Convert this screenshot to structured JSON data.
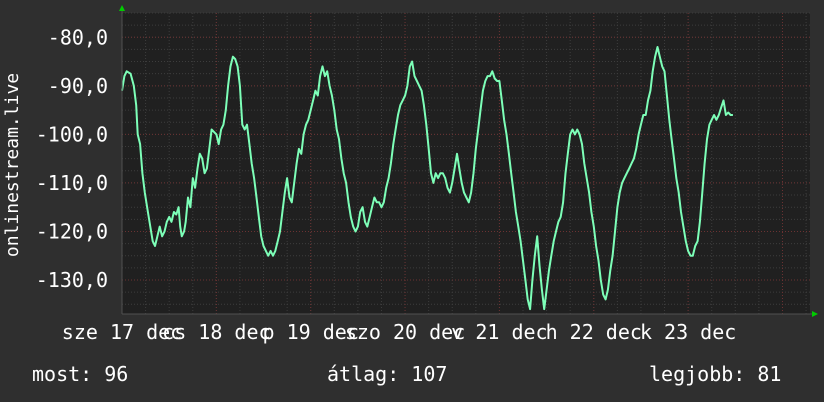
{
  "colors": {
    "background": "#2f2f2f",
    "canvas": "#202020",
    "line": "#7dffb8",
    "grid_minor": "#3d3d3d",
    "grid_major": "#6b3232",
    "axis_arrow": "#00cc00",
    "text": "#ffffff"
  },
  "stats": {
    "now_label": "most:",
    "now_value": "96",
    "avg_label": "átlag:",
    "avg_value": "107",
    "max_label": "legjobb:",
    "max_value": "81"
  },
  "chart_data": {
    "type": "line",
    "title": "",
    "xlabel": "",
    "ylabel": "onlinestream.live",
    "ylim": [
      -137,
      -75
    ],
    "yticks": [
      -80,
      -90,
      -100,
      -110,
      -120,
      -130
    ],
    "ytick_labels": [
      "-80,0",
      "-90,0",
      "-100,0",
      "-110,0",
      "-120,0",
      "-130,0"
    ],
    "xlim": [
      0,
      175
    ],
    "xticks": [
      0,
      24,
      48,
      72,
      96,
      120,
      144,
      168
    ],
    "xtick_labels": [
      "sze 17 dec",
      "cs 18 dec",
      "p 19 dec",
      "szo 20 dec",
      "v 21 dec",
      "h 22 dec",
      "k 23 dec",
      ""
    ],
    "grid": true,
    "series": [
      {
        "values": [
          [
            0,
            -91
          ],
          [
            0.6,
            -88
          ],
          [
            1.2,
            -87
          ],
          [
            2.2,
            -87.5
          ],
          [
            3,
            -90
          ],
          [
            3.6,
            -94
          ],
          [
            4,
            -100
          ],
          [
            4.6,
            -102
          ],
          [
            5.2,
            -108
          ],
          [
            5.8,
            -112
          ],
          [
            6.6,
            -116
          ],
          [
            7.2,
            -119
          ],
          [
            7.8,
            -122
          ],
          [
            8.4,
            -123
          ],
          [
            9,
            -121
          ],
          [
            9.6,
            -119
          ],
          [
            10.2,
            -121
          ],
          [
            10.8,
            -120
          ],
          [
            11.4,
            -118
          ],
          [
            12,
            -117
          ],
          [
            12.6,
            -118
          ],
          [
            13.2,
            -116
          ],
          [
            13.8,
            -116.5
          ],
          [
            14.4,
            -115
          ],
          [
            14.8,
            -119
          ],
          [
            15.2,
            -121
          ],
          [
            15.8,
            -120
          ],
          [
            16.2,
            -118
          ],
          [
            16.8,
            -113
          ],
          [
            17.4,
            -115
          ],
          [
            18,
            -109
          ],
          [
            18.6,
            -111
          ],
          [
            19.2,
            -107
          ],
          [
            19.8,
            -104
          ],
          [
            20.4,
            -105
          ],
          [
            21,
            -108
          ],
          [
            21.6,
            -107
          ],
          [
            22.2,
            -103
          ],
          [
            22.8,
            -99
          ],
          [
            23.4,
            -99.5
          ],
          [
            24,
            -100
          ],
          [
            24.6,
            -102
          ],
          [
            25.2,
            -99
          ],
          [
            25.8,
            -98
          ],
          [
            26.4,
            -95
          ],
          [
            27,
            -90
          ],
          [
            27.6,
            -86
          ],
          [
            28.2,
            -84
          ],
          [
            28.8,
            -84.5
          ],
          [
            29.4,
            -86
          ],
          [
            30,
            -90
          ],
          [
            30.6,
            -98
          ],
          [
            31.2,
            -99
          ],
          [
            31.8,
            -98
          ],
          [
            32.4,
            -102
          ],
          [
            33,
            -106
          ],
          [
            33.6,
            -109
          ],
          [
            34.2,
            -113
          ],
          [
            34.8,
            -117
          ],
          [
            35.4,
            -121
          ],
          [
            36,
            -123
          ],
          [
            36.6,
            -124
          ],
          [
            37.2,
            -125
          ],
          [
            37.8,
            -124
          ],
          [
            38.4,
            -125
          ],
          [
            39,
            -124
          ],
          [
            39.6,
            -122
          ],
          [
            40.2,
            -120
          ],
          [
            40.8,
            -116
          ],
          [
            41.4,
            -112
          ],
          [
            42,
            -109
          ],
          [
            42.6,
            -113
          ],
          [
            43.2,
            -114
          ],
          [
            43.8,
            -110
          ],
          [
            44.4,
            -106
          ],
          [
            45,
            -103
          ],
          [
            45.6,
            -104
          ],
          [
            46.2,
            -100
          ],
          [
            46.8,
            -98
          ],
          [
            47.4,
            -97
          ],
          [
            48,
            -95
          ],
          [
            48.6,
            -93
          ],
          [
            49.2,
            -91
          ],
          [
            49.8,
            -92
          ],
          [
            50.4,
            -88
          ],
          [
            51,
            -86
          ],
          [
            51.6,
            -88
          ],
          [
            52.2,
            -87
          ],
          [
            52.8,
            -90
          ],
          [
            53.4,
            -92
          ],
          [
            54,
            -95
          ],
          [
            54.6,
            -99
          ],
          [
            55.2,
            -101
          ],
          [
            55.8,
            -105
          ],
          [
            56.4,
            -108
          ],
          [
            57,
            -110
          ],
          [
            57.6,
            -114
          ],
          [
            58.2,
            -117
          ],
          [
            58.8,
            -119
          ],
          [
            59.4,
            -120
          ],
          [
            60,
            -119
          ],
          [
            60.6,
            -116
          ],
          [
            61.2,
            -115
          ],
          [
            61.8,
            -118
          ],
          [
            62.4,
            -119
          ],
          [
            63,
            -117
          ],
          [
            63.6,
            -115
          ],
          [
            64.2,
            -113
          ],
          [
            64.8,
            -114
          ],
          [
            65.4,
            -114
          ],
          [
            66,
            -115
          ],
          [
            66.6,
            -114
          ],
          [
            67.2,
            -111
          ],
          [
            67.8,
            -109
          ],
          [
            68.4,
            -106
          ],
          [
            69,
            -102
          ],
          [
            69.6,
            -99
          ],
          [
            70.2,
            -96
          ],
          [
            70.8,
            -94
          ],
          [
            71.4,
            -93
          ],
          [
            72,
            -92
          ],
          [
            72.6,
            -90
          ],
          [
            73.2,
            -86
          ],
          [
            73.8,
            -85
          ],
          [
            74.4,
            -88
          ],
          [
            75,
            -89
          ],
          [
            75.6,
            -90
          ],
          [
            76.2,
            -91
          ],
          [
            76.8,
            -94
          ],
          [
            77.4,
            -98
          ],
          [
            78,
            -103
          ],
          [
            78.6,
            -108
          ],
          [
            79.2,
            -110
          ],
          [
            79.8,
            -108
          ],
          [
            80.4,
            -109
          ],
          [
            81,
            -108
          ],
          [
            81.6,
            -108
          ],
          [
            82.2,
            -109
          ],
          [
            82.8,
            -111
          ],
          [
            83.4,
            -112
          ],
          [
            84,
            -110
          ],
          [
            84.6,
            -107
          ],
          [
            85.2,
            -104
          ],
          [
            85.8,
            -107
          ],
          [
            86.4,
            -110
          ],
          [
            87,
            -112
          ],
          [
            87.6,
            -113
          ],
          [
            88.2,
            -114
          ],
          [
            88.8,
            -112
          ],
          [
            89.4,
            -108
          ],
          [
            90,
            -103
          ],
          [
            90.6,
            -99
          ],
          [
            91.2,
            -95
          ],
          [
            91.8,
            -91
          ],
          [
            92.4,
            -89
          ],
          [
            93,
            -88
          ],
          [
            93.6,
            -88
          ],
          [
            94.2,
            -87
          ],
          [
            94.8,
            -88.5
          ],
          [
            95.4,
            -89
          ],
          [
            96,
            -89
          ],
          [
            96.6,
            -93
          ],
          [
            97.2,
            -97
          ],
          [
            97.8,
            -100
          ],
          [
            98.4,
            -104
          ],
          [
            99,
            -108
          ],
          [
            99.6,
            -112
          ],
          [
            100.2,
            -116
          ],
          [
            100.8,
            -119
          ],
          [
            101.4,
            -122
          ],
          [
            102,
            -126
          ],
          [
            102.6,
            -130
          ],
          [
            103.2,
            -134
          ],
          [
            103.8,
            -136
          ],
          [
            104.4,
            -130
          ],
          [
            105,
            -125
          ],
          [
            105.6,
            -121
          ],
          [
            106.2,
            -127
          ],
          [
            106.8,
            -132
          ],
          [
            107.4,
            -136
          ],
          [
            108,
            -132
          ],
          [
            108.6,
            -128
          ],
          [
            109.2,
            -125
          ],
          [
            109.8,
            -122
          ],
          [
            110.4,
            -120
          ],
          [
            111,
            -118
          ],
          [
            111.6,
            -117
          ],
          [
            112.2,
            -114
          ],
          [
            112.8,
            -108
          ],
          [
            113.4,
            -104
          ],
          [
            114,
            -100
          ],
          [
            114.6,
            -99
          ],
          [
            115.2,
            -100
          ],
          [
            115.8,
            -99
          ],
          [
            116.4,
            -100
          ],
          [
            117,
            -102
          ],
          [
            117.6,
            -106
          ],
          [
            118.2,
            -109
          ],
          [
            118.8,
            -112
          ],
          [
            119.4,
            -116
          ],
          [
            120,
            -119
          ],
          [
            120.6,
            -123
          ],
          [
            121.2,
            -126
          ],
          [
            121.8,
            -130
          ],
          [
            122.4,
            -133
          ],
          [
            123,
            -134
          ],
          [
            123.6,
            -132
          ],
          [
            124.2,
            -128
          ],
          [
            124.8,
            -125
          ],
          [
            125.4,
            -120
          ],
          [
            126,
            -115
          ],
          [
            126.6,
            -112
          ],
          [
            127.2,
            -110
          ],
          [
            127.8,
            -109
          ],
          [
            128.4,
            -108
          ],
          [
            129,
            -107
          ],
          [
            129.6,
            -106
          ],
          [
            130.2,
            -105
          ],
          [
            130.8,
            -103
          ],
          [
            131.4,
            -100
          ],
          [
            132,
            -98
          ],
          [
            132.6,
            -96
          ],
          [
            133.2,
            -96
          ],
          [
            133.8,
            -93
          ],
          [
            134.4,
            -91
          ],
          [
            135,
            -87
          ],
          [
            135.6,
            -84
          ],
          [
            136.2,
            -82
          ],
          [
            136.8,
            -84
          ],
          [
            137.4,
            -86
          ],
          [
            138,
            -87
          ],
          [
            138.6,
            -92
          ],
          [
            139.2,
            -97
          ],
          [
            139.8,
            -101
          ],
          [
            140.4,
            -105
          ],
          [
            141,
            -109
          ],
          [
            141.6,
            -112
          ],
          [
            142.2,
            -116
          ],
          [
            142.8,
            -119
          ],
          [
            143.4,
            -122
          ],
          [
            144,
            -124
          ],
          [
            144.6,
            -125
          ],
          [
            145.2,
            -125
          ],
          [
            145.8,
            -123
          ],
          [
            146.4,
            -122
          ],
          [
            147,
            -118
          ],
          [
            147.6,
            -112
          ],
          [
            148.2,
            -106
          ],
          [
            148.8,
            -101
          ],
          [
            149.4,
            -98
          ],
          [
            150,
            -97
          ],
          [
            150.6,
            -96
          ],
          [
            151.2,
            -97
          ],
          [
            151.8,
            -96
          ],
          [
            152.4,
            -94.5
          ],
          [
            153,
            -93
          ],
          [
            153.6,
            -96
          ],
          [
            154.2,
            -95.5
          ],
          [
            154.8,
            -96
          ],
          [
            155.4,
            -96
          ]
        ]
      }
    ]
  }
}
